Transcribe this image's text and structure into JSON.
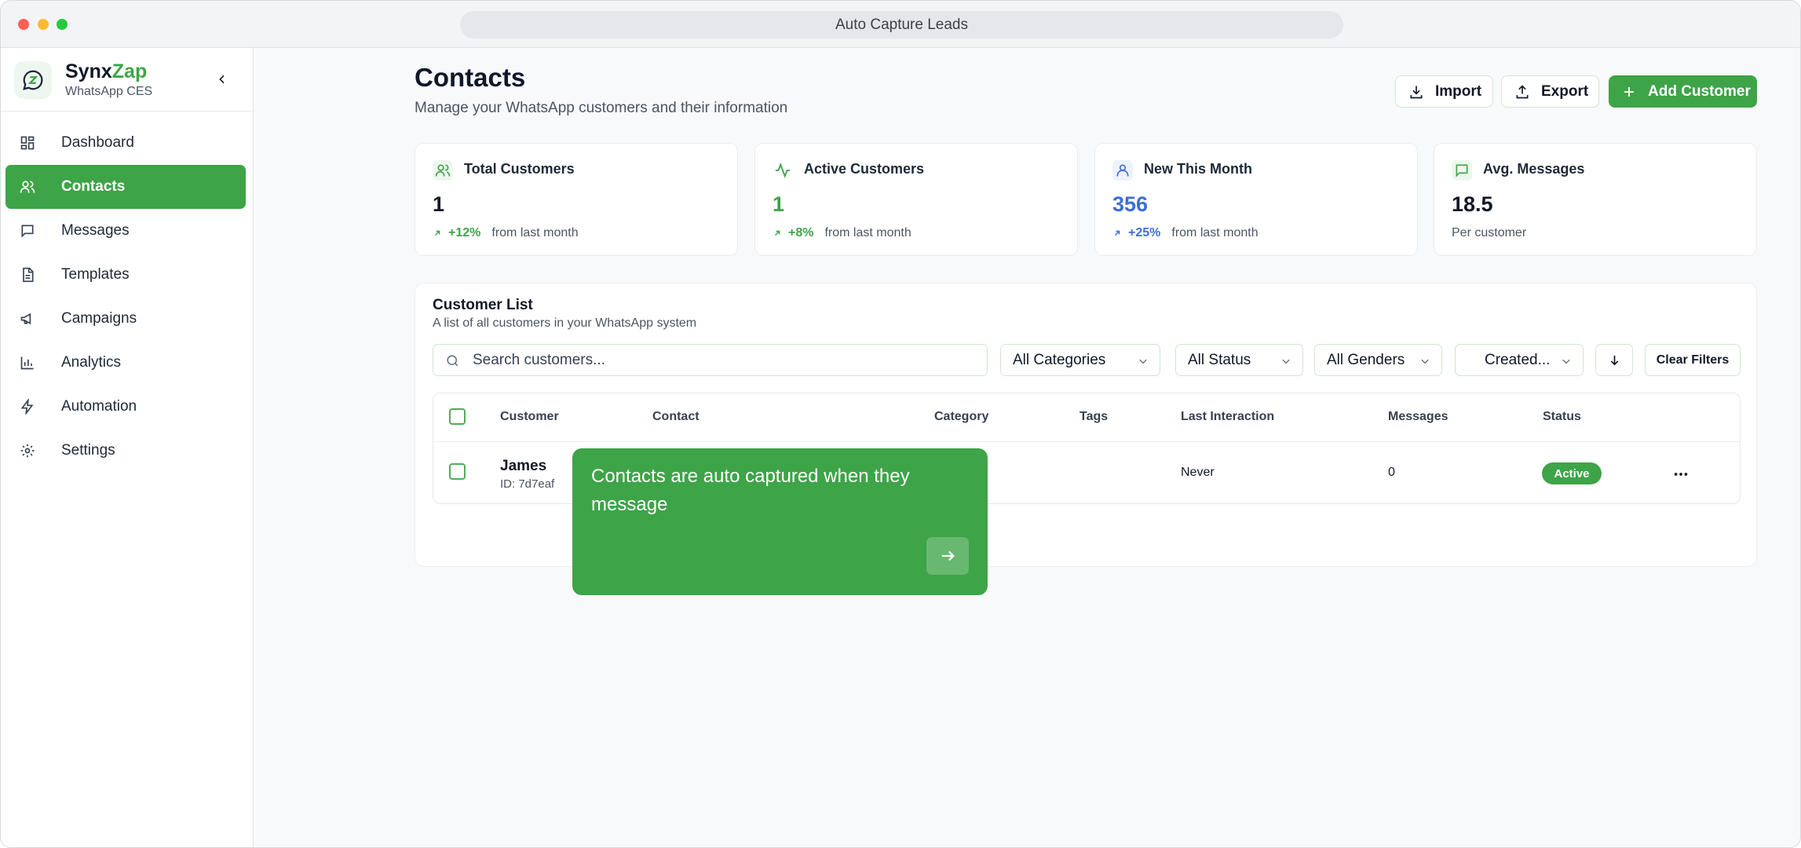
{
  "window": {
    "title": "Auto Capture Leads"
  },
  "brand": {
    "name_main": "Synx",
    "name_accent": "Zap",
    "subtitle": "WhatsApp CES"
  },
  "sidebar": {
    "items": [
      {
        "label": "Dashboard",
        "icon": "dashboard-icon",
        "active": false
      },
      {
        "label": "Contacts",
        "icon": "users-icon",
        "active": true
      },
      {
        "label": "Messages",
        "icon": "message-icon",
        "active": false
      },
      {
        "label": "Templates",
        "icon": "file-text-icon",
        "active": false
      },
      {
        "label": "Campaigns",
        "icon": "megaphone-icon",
        "active": false
      },
      {
        "label": "Analytics",
        "icon": "bar-chart-icon",
        "active": false
      },
      {
        "label": "Automation",
        "icon": "lightning-icon",
        "active": false
      },
      {
        "label": "Settings",
        "icon": "gear-icon",
        "active": false
      }
    ]
  },
  "header": {
    "title": "Contacts",
    "subtitle": "Manage your WhatsApp customers and their information",
    "import_label": "Import",
    "export_label": "Export",
    "add_label": "Add Customer"
  },
  "stats": [
    {
      "title": "Total Customers",
      "value": "1",
      "trend": "+12%",
      "foot": "from last month",
      "icon": "users-icon"
    },
    {
      "title": "Active Customers",
      "value": "1",
      "trend": "+8%",
      "foot": "from last month",
      "icon": "activity-icon"
    },
    {
      "title": "New This Month",
      "value": "356",
      "trend": "+25%",
      "foot": "from last month",
      "icon": "user-icon"
    },
    {
      "title": "Avg. Messages",
      "value": "18.5",
      "trend": "",
      "foot": "Per customer",
      "icon": "message-icon"
    }
  ],
  "customer_list": {
    "title": "Customer List",
    "subtitle": "A list of all customers in your WhatsApp system",
    "search_placeholder": "Search customers...",
    "filters": {
      "categories": "All Categories",
      "status": "All Status",
      "genders": "All Genders",
      "created": "Created..."
    },
    "clear_label": "Clear Filters",
    "columns": [
      "Customer",
      "Contact",
      "Category",
      "Tags",
      "Last Interaction",
      "Messages",
      "Status"
    ],
    "rows": [
      {
        "name": "James",
        "id": "ID: 7d7eaf",
        "last_interaction": "Never",
        "messages": "0",
        "status": "Active"
      }
    ]
  },
  "tooltip": {
    "text": "Contacts are auto captured when they message"
  },
  "colors": {
    "accent": "#3ea448",
    "value_blue": "#3b6fd8"
  }
}
